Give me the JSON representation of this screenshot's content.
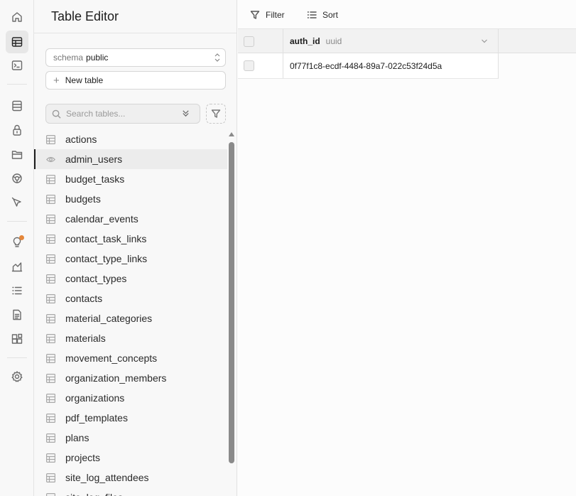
{
  "rail": {
    "items": [
      {
        "name": "home-icon",
        "label": "Home"
      },
      {
        "name": "table-editor-icon",
        "label": "Table Editor"
      },
      {
        "name": "sql-editor-icon",
        "label": "SQL Editor"
      },
      {
        "name": "database-icon",
        "label": "Database"
      },
      {
        "name": "auth-icon",
        "label": "Authentication"
      },
      {
        "name": "storage-icon",
        "label": "Storage"
      },
      {
        "name": "realtime-icon",
        "label": "Realtime"
      },
      {
        "name": "edge-functions-icon",
        "label": "Edge Functions"
      },
      {
        "name": "advisors-icon",
        "label": "Advisors"
      },
      {
        "name": "reports-icon",
        "label": "Reports"
      },
      {
        "name": "logs-icon",
        "label": "Logs"
      },
      {
        "name": "api-docs-icon",
        "label": "API Docs"
      },
      {
        "name": "integrations-icon",
        "label": "Integrations"
      },
      {
        "name": "settings-icon",
        "label": "Settings"
      }
    ],
    "active": "table-editor-icon"
  },
  "panel": {
    "title": "Table Editor",
    "schema_label": "schema",
    "schema_value": "public",
    "new_table_label": "New table",
    "search_placeholder": "Search tables...",
    "tables": [
      {
        "label": "actions",
        "kind": "table"
      },
      {
        "label": "admin_users",
        "kind": "view",
        "active": true
      },
      {
        "label": "budget_tasks",
        "kind": "table"
      },
      {
        "label": "budgets",
        "kind": "table"
      },
      {
        "label": "calendar_events",
        "kind": "table"
      },
      {
        "label": "contact_task_links",
        "kind": "table"
      },
      {
        "label": "contact_type_links",
        "kind": "table"
      },
      {
        "label": "contact_types",
        "kind": "table"
      },
      {
        "label": "contacts",
        "kind": "table"
      },
      {
        "label": "material_categories",
        "kind": "table"
      },
      {
        "label": "materials",
        "kind": "table"
      },
      {
        "label": "movement_concepts",
        "kind": "table"
      },
      {
        "label": "organization_members",
        "kind": "table"
      },
      {
        "label": "organizations",
        "kind": "table"
      },
      {
        "label": "pdf_templates",
        "kind": "table"
      },
      {
        "label": "plans",
        "kind": "table"
      },
      {
        "label": "projects",
        "kind": "table"
      },
      {
        "label": "site_log_attendees",
        "kind": "table"
      },
      {
        "label": "site_log_files",
        "kind": "table"
      }
    ]
  },
  "toolbar": {
    "filter_label": "Filter",
    "sort_label": "Sort"
  },
  "grid": {
    "columns": [
      {
        "name": "auth_id",
        "type": "uuid"
      }
    ],
    "rows": [
      {
        "auth_id": "0f77f1c8-ecdf-4484-89a7-022c53f24d5a"
      }
    ]
  },
  "colors": {
    "notification_dot": "#e4863a",
    "active_bar": "#1c1c1c"
  }
}
